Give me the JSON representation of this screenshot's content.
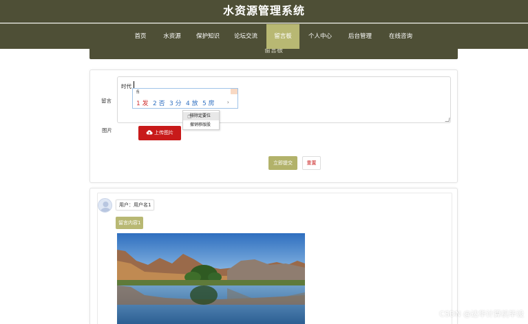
{
  "header": {
    "site_title": "水资源管理系统"
  },
  "nav": {
    "items": [
      {
        "label": "首页"
      },
      {
        "label": "水资源"
      },
      {
        "label": "保护知识"
      },
      {
        "label": "论坛交流"
      },
      {
        "label": "留言板"
      },
      {
        "label": "个人中心"
      },
      {
        "label": "后台管理"
      },
      {
        "label": "在线咨询"
      }
    ],
    "active_index": 4
  },
  "board": {
    "title": "留言板"
  },
  "form": {
    "message_label": "留言",
    "message_value": "时代",
    "image_label": "图片",
    "upload_label": "上传图片",
    "upload_icon": "cloud-upload-icon",
    "submit_label": "立即提交",
    "reset_label": "重置"
  },
  "ime": {
    "composition": "fi",
    "candidates": [
      "1 发",
      "2 否",
      "3 分",
      "4 放",
      "5 房"
    ],
    "next_icon": "chevron-right-icon"
  },
  "context_menu": {
    "items": [
      "排除定要位",
      "撤销移版股"
    ]
  },
  "messages": [
    {
      "user": "用户：用户名1",
      "content": "留言内容1",
      "avatar_icon": "user-avatar-icon"
    }
  ],
  "watermark": "CSDN @达华计算机毕设",
  "colors": {
    "header_bg": "#4e4f36",
    "nav_active": "#b8b873",
    "upload_btn": "#c81a1a",
    "submit_btn": "#b2b26a"
  }
}
